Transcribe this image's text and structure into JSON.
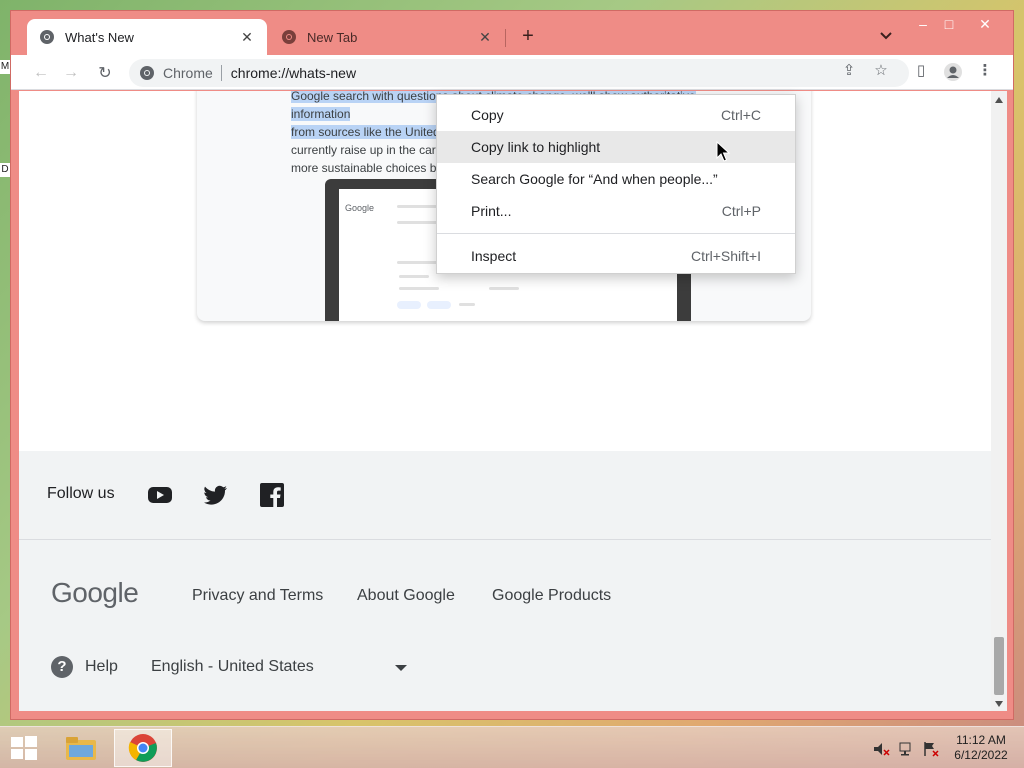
{
  "desktop": {
    "edge_letters": [
      "M",
      "D"
    ]
  },
  "window": {
    "tabs": [
      {
        "title": "What's New",
        "active": true
      },
      {
        "title": "New Tab",
        "active": false
      }
    ],
    "controls": {
      "minimize": "–",
      "maximize": "□",
      "close": "✕"
    }
  },
  "toolbar": {
    "chip": "Chrome",
    "url": "chrome://whats-new"
  },
  "card": {
    "text_line1": "Google search with questions about climate change, we'll show authoritative information",
    "text_line2": "from sources like the United N",
    "text_line3": "currently raise up in the carous",
    "text_line4": "more sustainable choices by 2"
  },
  "context_menu": {
    "items": [
      {
        "label": "Copy",
        "shortcut": "Ctrl+C"
      },
      {
        "label": "Copy link to highlight",
        "shortcut": ""
      },
      {
        "label": "Search Google for “And when people...”",
        "shortcut": ""
      },
      {
        "label": "Print...",
        "shortcut": "Ctrl+P"
      },
      {
        "label": "Inspect",
        "shortcut": "Ctrl+Shift+I"
      }
    ]
  },
  "footer": {
    "follow_label": "Follow us",
    "logo": "Google",
    "links": [
      "Privacy and Terms",
      "About Google",
      "Google Products"
    ],
    "help_label": "Help",
    "language": "English - United States"
  },
  "taskbar": {
    "time": "11:12 AM",
    "date": "6/12/2022"
  },
  "colors": {
    "window_frame": "#ef8c86",
    "selection": "#b9d3f5",
    "footer_bg": "#f1f3f4"
  }
}
